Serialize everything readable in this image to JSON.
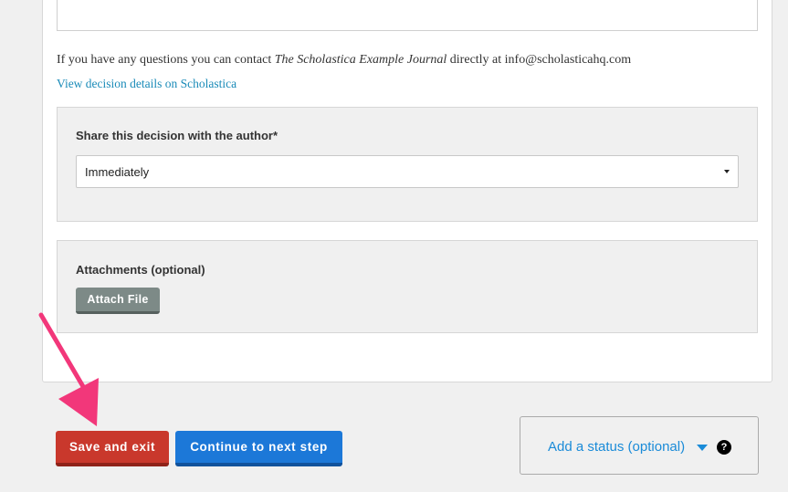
{
  "contact": {
    "prefix": "If you have any questions you can contact ",
    "journal": "The Scholastica Example Journal",
    "suffix": " directly at info@scholasticahq.com"
  },
  "view_link": "View decision details on Scholastica",
  "share": {
    "label": "Share this decision with the author*",
    "selected": "Immediately"
  },
  "attachments": {
    "label": "Attachments (optional)",
    "button": "Attach File"
  },
  "actions": {
    "save_exit": "Save and exit",
    "continue": "Continue to next step"
  },
  "status": {
    "label": "Add a status (optional)",
    "help": "?"
  },
  "colors": {
    "save": "#c9382c",
    "continue": "#1c78d8",
    "link": "#1a8bb8",
    "annotation_arrow": "#f2377a"
  },
  "icons": {
    "help": "question-circle-icon",
    "status_caret": "caret-down-icon",
    "select_caret": "select-caret-icon",
    "annotation": "pink-arrow-annotation"
  }
}
